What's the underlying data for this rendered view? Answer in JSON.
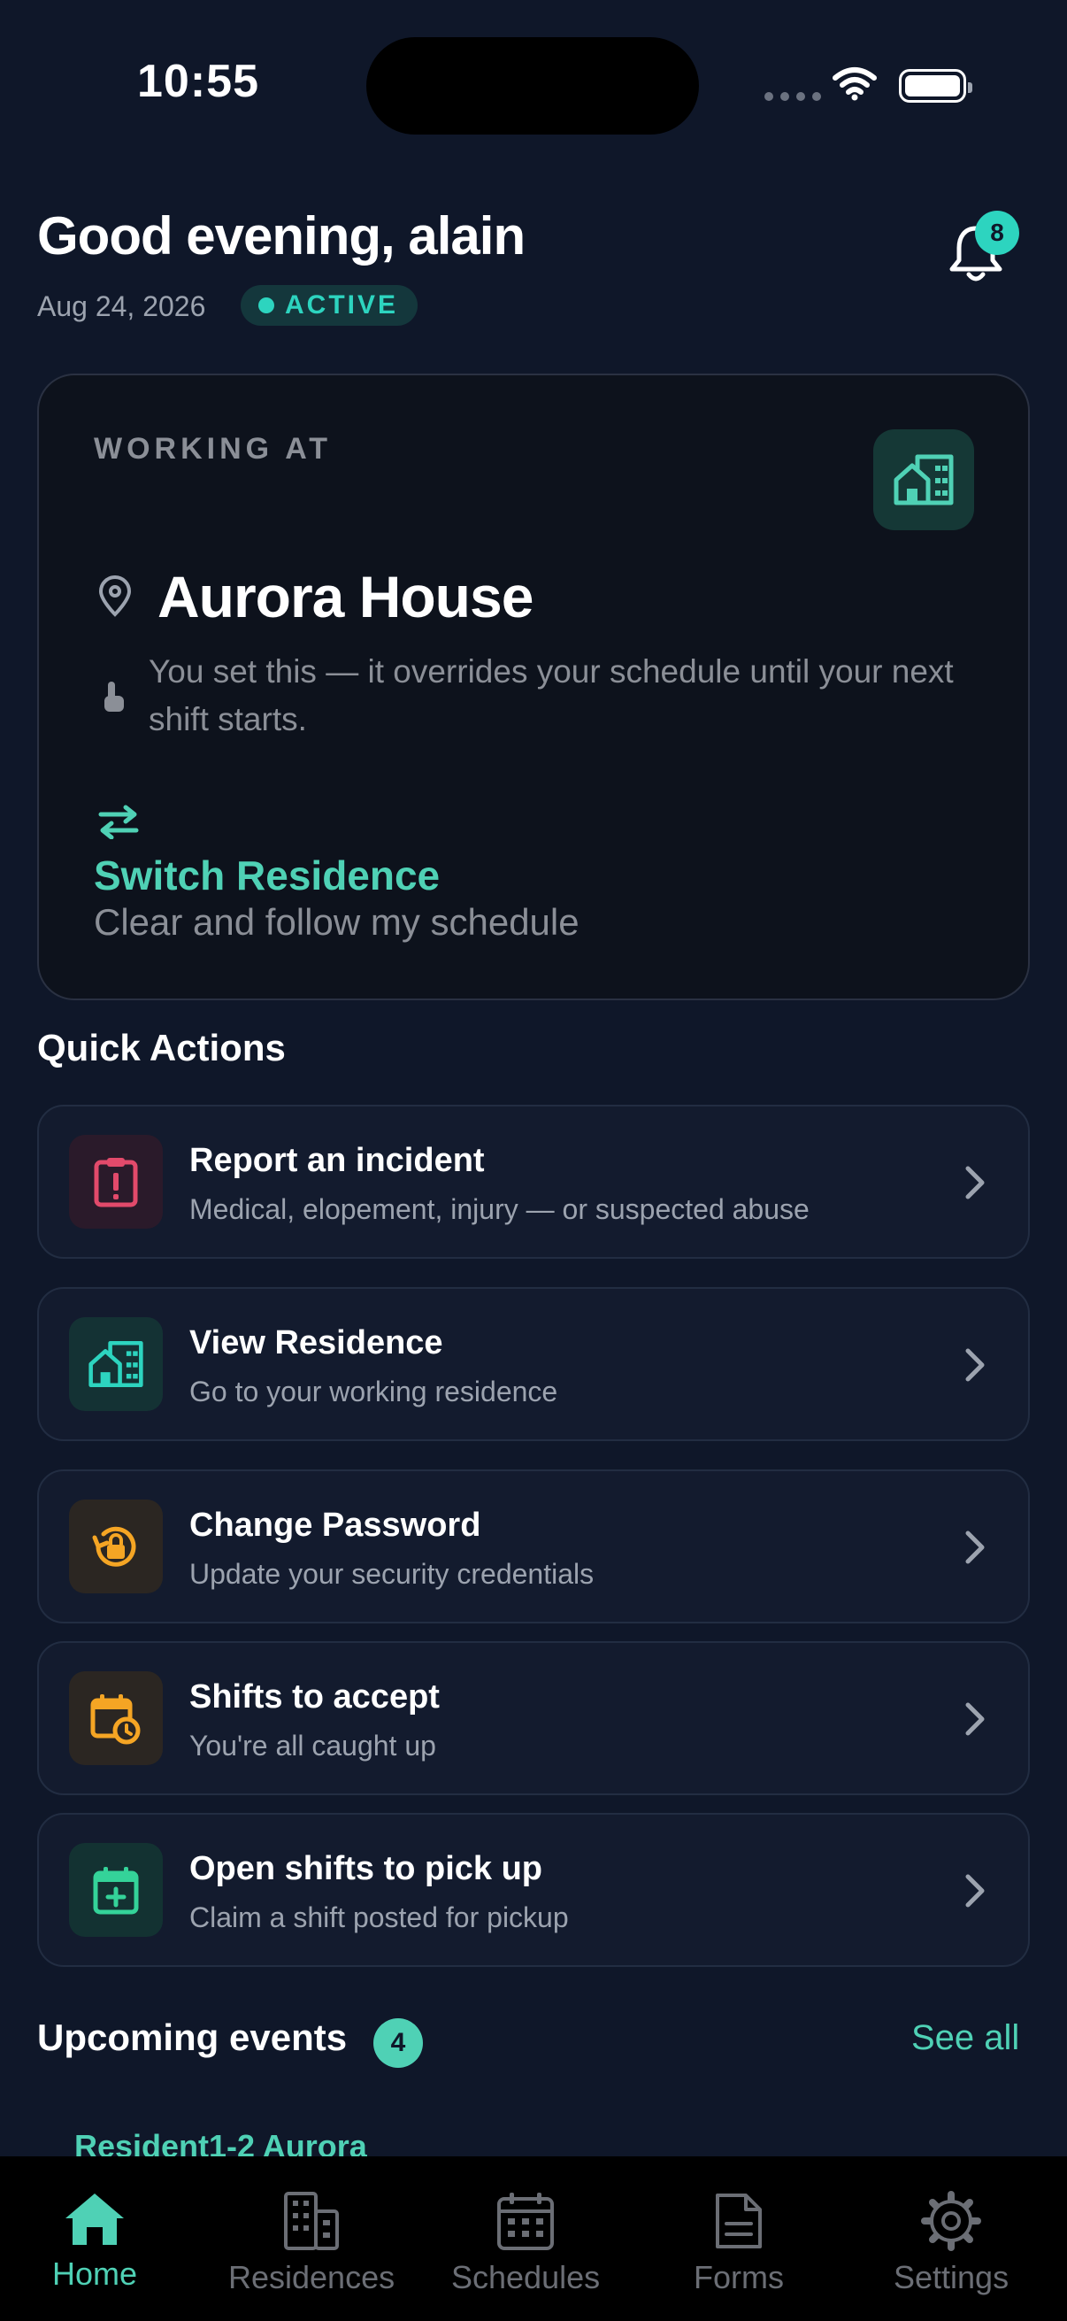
{
  "status_bar": {
    "time": "10:55"
  },
  "header": {
    "greeting": "Good evening, alain",
    "date": "Aug 24, 2026",
    "status": "ACTIVE",
    "notification_count": "8"
  },
  "working_card": {
    "label": "WORKING AT",
    "residence": "Aurora House",
    "override_note": "You set this — it overrides your schedule until your next shift starts.",
    "switch_title": "Switch Residence",
    "switch_subtitle": "Clear and follow my schedule"
  },
  "quick_actions": {
    "title": "Quick Actions",
    "items": [
      {
        "title": "Report an incident",
        "subtitle": "Medical, elopement, injury — or suspected abuse",
        "icon": "clipboard-alert-icon",
        "color": "#e24a6b"
      },
      {
        "title": "View Residence",
        "subtitle": "Go to your working residence",
        "icon": "building-icon",
        "color": "#2dd4bf"
      },
      {
        "title": "Change Password",
        "subtitle": "Update your security credentials",
        "icon": "lock-reset-icon",
        "color": "#f5a524"
      },
      {
        "title": "Shifts to accept",
        "subtitle": "You're all caught up",
        "icon": "calendar-clock-icon",
        "color": "#f5a524"
      },
      {
        "title": "Open shifts to pick up",
        "subtitle": "Claim a shift posted for pickup",
        "icon": "calendar-plus-icon",
        "color": "#34d399"
      }
    ]
  },
  "upcoming": {
    "title": "Upcoming events",
    "count": "4",
    "see_all": "See all",
    "first_event": "Resident1-2 Aurora"
  },
  "tabs": [
    {
      "label": "Home",
      "icon": "home-icon",
      "active": true
    },
    {
      "label": "Residences",
      "icon": "residences-icon",
      "active": false
    },
    {
      "label": "Schedules",
      "icon": "calendar-icon",
      "active": false
    },
    {
      "label": "Forms",
      "icon": "document-icon",
      "active": false
    },
    {
      "label": "Settings",
      "icon": "gear-icon",
      "active": false
    }
  ],
  "colors": {
    "accent": "#4fd1b5",
    "background": "#0f1729",
    "card": "#131b2e"
  }
}
